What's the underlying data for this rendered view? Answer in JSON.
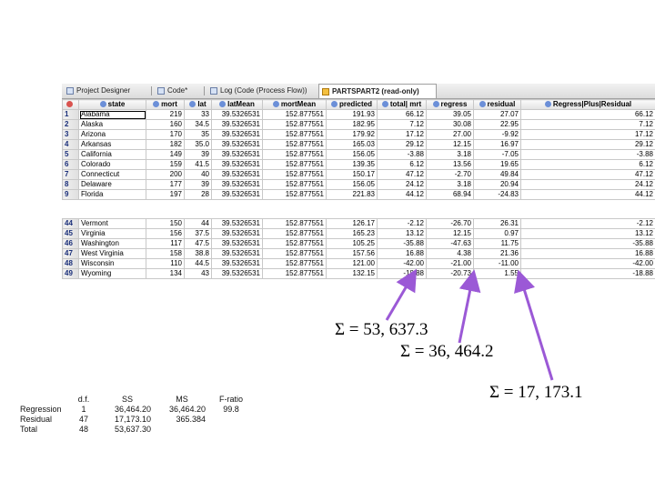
{
  "tabs": [
    {
      "label": "Project Designer",
      "icon": "project-designer-icon"
    },
    {
      "label": "Code*",
      "icon": "code-icon"
    },
    {
      "label": "Log (Code (Process Flow))",
      "icon": "log-icon"
    },
    {
      "label": "PARTSPART2 (read-only)",
      "icon": "table-icon",
      "active": true
    }
  ],
  "table": {
    "columns": [
      "state",
      "mort",
      "lat",
      "latMean",
      "mortMean",
      "predicted",
      "total| mrt",
      "regress",
      "residual",
      "Regress|Plus|Residual"
    ],
    "top_rows": [
      {
        "n": "1",
        "cells": [
          "Alabama",
          "219",
          "33",
          "39.5326531",
          "152.877551",
          "191.93",
          "66.12",
          "39.05",
          "27.07",
          "66.12"
        ]
      },
      {
        "n": "2",
        "cells": [
          "Alaska",
          "160",
          "34.5",
          "39.5326531",
          "152.877551",
          "182.95",
          "7.12",
          "30.08",
          "22.95",
          "7.12"
        ]
      },
      {
        "n": "3",
        "cells": [
          "Arizona",
          "170",
          "35",
          "39.5326531",
          "152.877551",
          "179.92",
          "17.12",
          "27.00",
          "-9.92",
          "17.12"
        ]
      },
      {
        "n": "4",
        "cells": [
          "Arkansas",
          "182",
          "35.0",
          "39.5326531",
          "152.877551",
          "165.03",
          "29.12",
          "12.15",
          "16.97",
          "29.12"
        ]
      },
      {
        "n": "5",
        "cells": [
          "California",
          "149",
          "39",
          "39.5326531",
          "152.877551",
          "156.05",
          "-3.88",
          "3.18",
          "-7.05",
          "-3.88"
        ]
      },
      {
        "n": "6",
        "cells": [
          "Colorado",
          "159",
          "41.5",
          "39.5326531",
          "152.877551",
          "139.35",
          "6.12",
          "13.56",
          "19.65",
          "6.12"
        ]
      },
      {
        "n": "7",
        "cells": [
          "Connecticut",
          "200",
          "40",
          "39.5326531",
          "152.877551",
          "150.17",
          "47.12",
          "-2.70",
          "49.84",
          "47.12"
        ]
      },
      {
        "n": "8",
        "cells": [
          "Delaware",
          "177",
          "39",
          "39.5326531",
          "152.877551",
          "156.05",
          "24.12",
          "3.18",
          "20.94",
          "24.12"
        ]
      },
      {
        "n": "9",
        "cells": [
          "Florida",
          "197",
          "28",
          "39.5326531",
          "152.877551",
          "221.83",
          "44.12",
          "68.94",
          "-24.83",
          "44.12"
        ]
      }
    ],
    "bottom_rows": [
      {
        "n": "44",
        "cells": [
          "Vermont",
          "150",
          "44",
          "39.5326531",
          "152.877551",
          "126.17",
          "-2.12",
          "-26.70",
          "26.31",
          "-2.12"
        ]
      },
      {
        "n": "45",
        "cells": [
          "Virginia",
          "156",
          "37.5",
          "39.5326531",
          "152.877551",
          "165.23",
          "13.12",
          "12.15",
          "0.97",
          "13.12"
        ]
      },
      {
        "n": "46",
        "cells": [
          "Washington",
          "117",
          "47.5",
          "39.5326531",
          "152.877551",
          "105.25",
          "-35.88",
          "-47.63",
          "11.75",
          "-35.88"
        ]
      },
      {
        "n": "47",
        "cells": [
          "West Virginia",
          "158",
          "38.8",
          "39.5326531",
          "152.877551",
          "157.56",
          "16.88",
          "4.38",
          "21.36",
          "16.88"
        ]
      },
      {
        "n": "48",
        "cells": [
          "Wisconsin",
          "110",
          "44.5",
          "39.5326531",
          "152.877551",
          "121.00",
          "-42.00",
          "-21.00",
          "-11.00",
          "-42.00"
        ]
      },
      {
        "n": "49",
        "cells": [
          "Wyoming",
          "134",
          "43",
          "39.5326531",
          "152.877551",
          "132.15",
          "-18.88",
          "-20.73",
          "1.55",
          "-18.88"
        ]
      }
    ]
  },
  "annotations": {
    "total": "Σ = 53, 637.3",
    "regress": "Σ = 36, 464.2",
    "residual": "Σ = 17, 173.1"
  },
  "anova": {
    "headers": [
      "",
      "d.f.",
      "SS",
      "MS",
      "F-ratio"
    ],
    "rows": [
      [
        "Regression",
        "1",
        "36,464.20",
        "36,464.20",
        "99.8"
      ],
      [
        "Residual",
        "47",
        "17,173.10",
        "365.384",
        ""
      ],
      [
        "Total",
        "48",
        "53,637.30",
        "",
        ""
      ]
    ]
  },
  "colors": {
    "arrow": "#9b59d6",
    "row_number": "#1a2f7a",
    "header_icon": "#6b8fd8"
  }
}
